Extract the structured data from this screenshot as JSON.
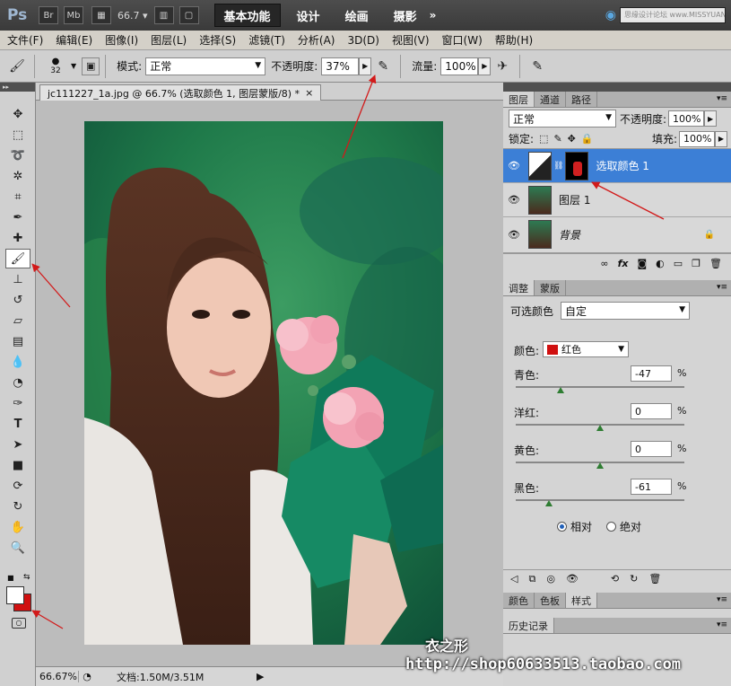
{
  "appbar": {
    "logo": "Ps",
    "bridge": "Br",
    "minibridge": "Mb",
    "zoom": "66.7",
    "workspaces": [
      "基本功能",
      "设计",
      "绘画",
      "摄影"
    ],
    "more": "»",
    "cslive_text": "思缘设计论坛",
    "search_placeholder": "www.MISSYUAN.COM"
  },
  "menubar": {
    "items": [
      "文件(F)",
      "编辑(E)",
      "图像(I)",
      "图层(L)",
      "选择(S)",
      "滤镜(T)",
      "分析(A)",
      "3D(D)",
      "视图(V)",
      "窗口(W)",
      "帮助(H)"
    ]
  },
  "options": {
    "brush_size": "32",
    "mode_label": "模式:",
    "mode_value": "正常",
    "opacity_label": "不透明度:",
    "opacity_value": "37%",
    "flow_label": "流量:",
    "flow_value": "100%"
  },
  "document": {
    "tab_title": "jc111227_1a.jpg @ 66.7% (选取颜色 1, 图层蒙版/8) *",
    "close": "×",
    "status_zoom": "66.67%",
    "status_doc": "文档:1.50M/3.51M"
  },
  "layers_panel": {
    "tabs": [
      "图层",
      "通道",
      "路径"
    ],
    "blend_mode": "正常",
    "opacity_label": "不透明度:",
    "opacity_value": "100%",
    "lock_label": "锁定:",
    "fill_label": "填充:",
    "fill_value": "100%",
    "layers": [
      {
        "name": "选取颜色 1",
        "selected": true
      },
      {
        "name": "图层 1",
        "selected": false
      },
      {
        "name": "背景",
        "selected": false
      }
    ]
  },
  "adjust_panel": {
    "tabs": [
      "调整",
      "蒙版"
    ],
    "title": "可选颜色",
    "preset": "自定",
    "colors_label": "颜色:",
    "colors_value": "红色",
    "sliders": [
      {
        "label": "青色:",
        "value": "-47",
        "unit": "%",
        "pos": -0.47
      },
      {
        "label": "洋红:",
        "value": "0",
        "unit": "%",
        "pos": 0
      },
      {
        "label": "黄色:",
        "value": "0",
        "unit": "%",
        "pos": 0
      },
      {
        "label": "黑色:",
        "value": "-61",
        "unit": "%",
        "pos": -0.61
      }
    ],
    "radio_relative": "相对",
    "radio_absolute": "绝对"
  },
  "bottom_panel": {
    "tabs": [
      "颜色",
      "色板",
      "样式"
    ],
    "history_tab": "历史记录"
  },
  "watermark": {
    "brand": "衣之形",
    "url": "http://shop60633513.taobao.com"
  },
  "colors": {
    "selection_blue": "#3c7fd6",
    "annotation_red": "#d21a1a",
    "swatch_red": "#d01010"
  }
}
